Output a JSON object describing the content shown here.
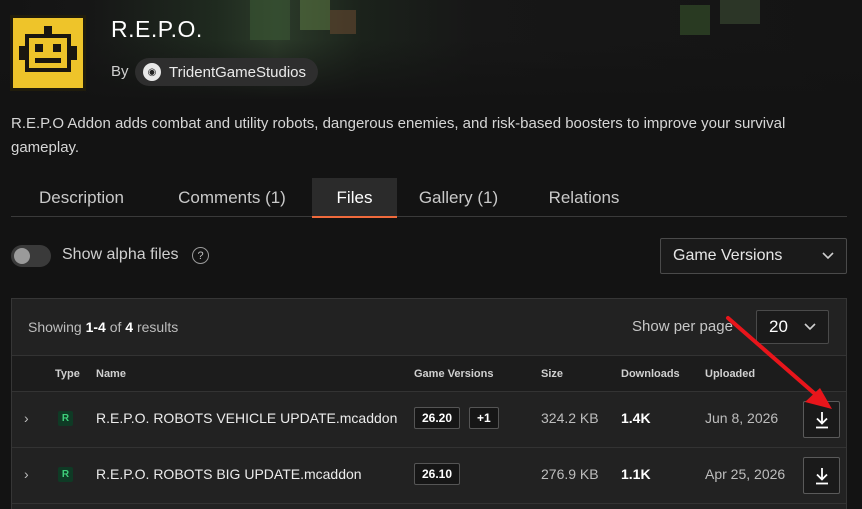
{
  "project": {
    "title": "R.E.P.O.",
    "by_label": "By",
    "author": "TridentGameStudios",
    "description": "R.E.P.O Addon adds combat and utility robots, dangerous enemies, and risk-based boosters to improve your survival gameplay."
  },
  "tabs": [
    {
      "label": "Description",
      "active": false
    },
    {
      "label": "Comments (1)",
      "active": false
    },
    {
      "label": "Files",
      "active": true
    },
    {
      "label": "Gallery (1)",
      "active": false
    },
    {
      "label": "Relations",
      "active": false
    }
  ],
  "filters": {
    "alpha_label": "Show alpha files",
    "alpha_enabled": false,
    "help_icon": "?",
    "game_versions_label": "Game Versions",
    "chevron_icon": "chevron-down-icon"
  },
  "results": {
    "prefix": "Showing",
    "range": "1-4",
    "of": "of",
    "total": "4",
    "suffix": "results",
    "per_page_label": "Show per page",
    "per_page_value": "20"
  },
  "table": {
    "headers": {
      "type": "Type",
      "name": "Name",
      "game_versions": "Game Versions",
      "size": "Size",
      "downloads": "Downloads",
      "uploaded": "Uploaded"
    },
    "rows": [
      {
        "type": "R",
        "name": "R.E.P.O. ROBOTS VEHICLE UPDATE.mcaddon",
        "version": "26.20",
        "extra_versions": "+1",
        "size": "324.2 KB",
        "downloads": "1.4K",
        "uploaded": "Jun 8, 2026"
      },
      {
        "type": "R",
        "name": "R.E.P.O. ROBOTS BIG UPDATE.mcaddon",
        "version": "26.10",
        "extra_versions": "",
        "size": "276.9 KB",
        "downloads": "1.1K",
        "uploaded": "Apr 25, 2026"
      }
    ]
  },
  "colors": {
    "background": "#131313",
    "accent": "#f06a3c",
    "release_badge": "#3fcf7a",
    "annotation_arrow": "#e8151b"
  }
}
